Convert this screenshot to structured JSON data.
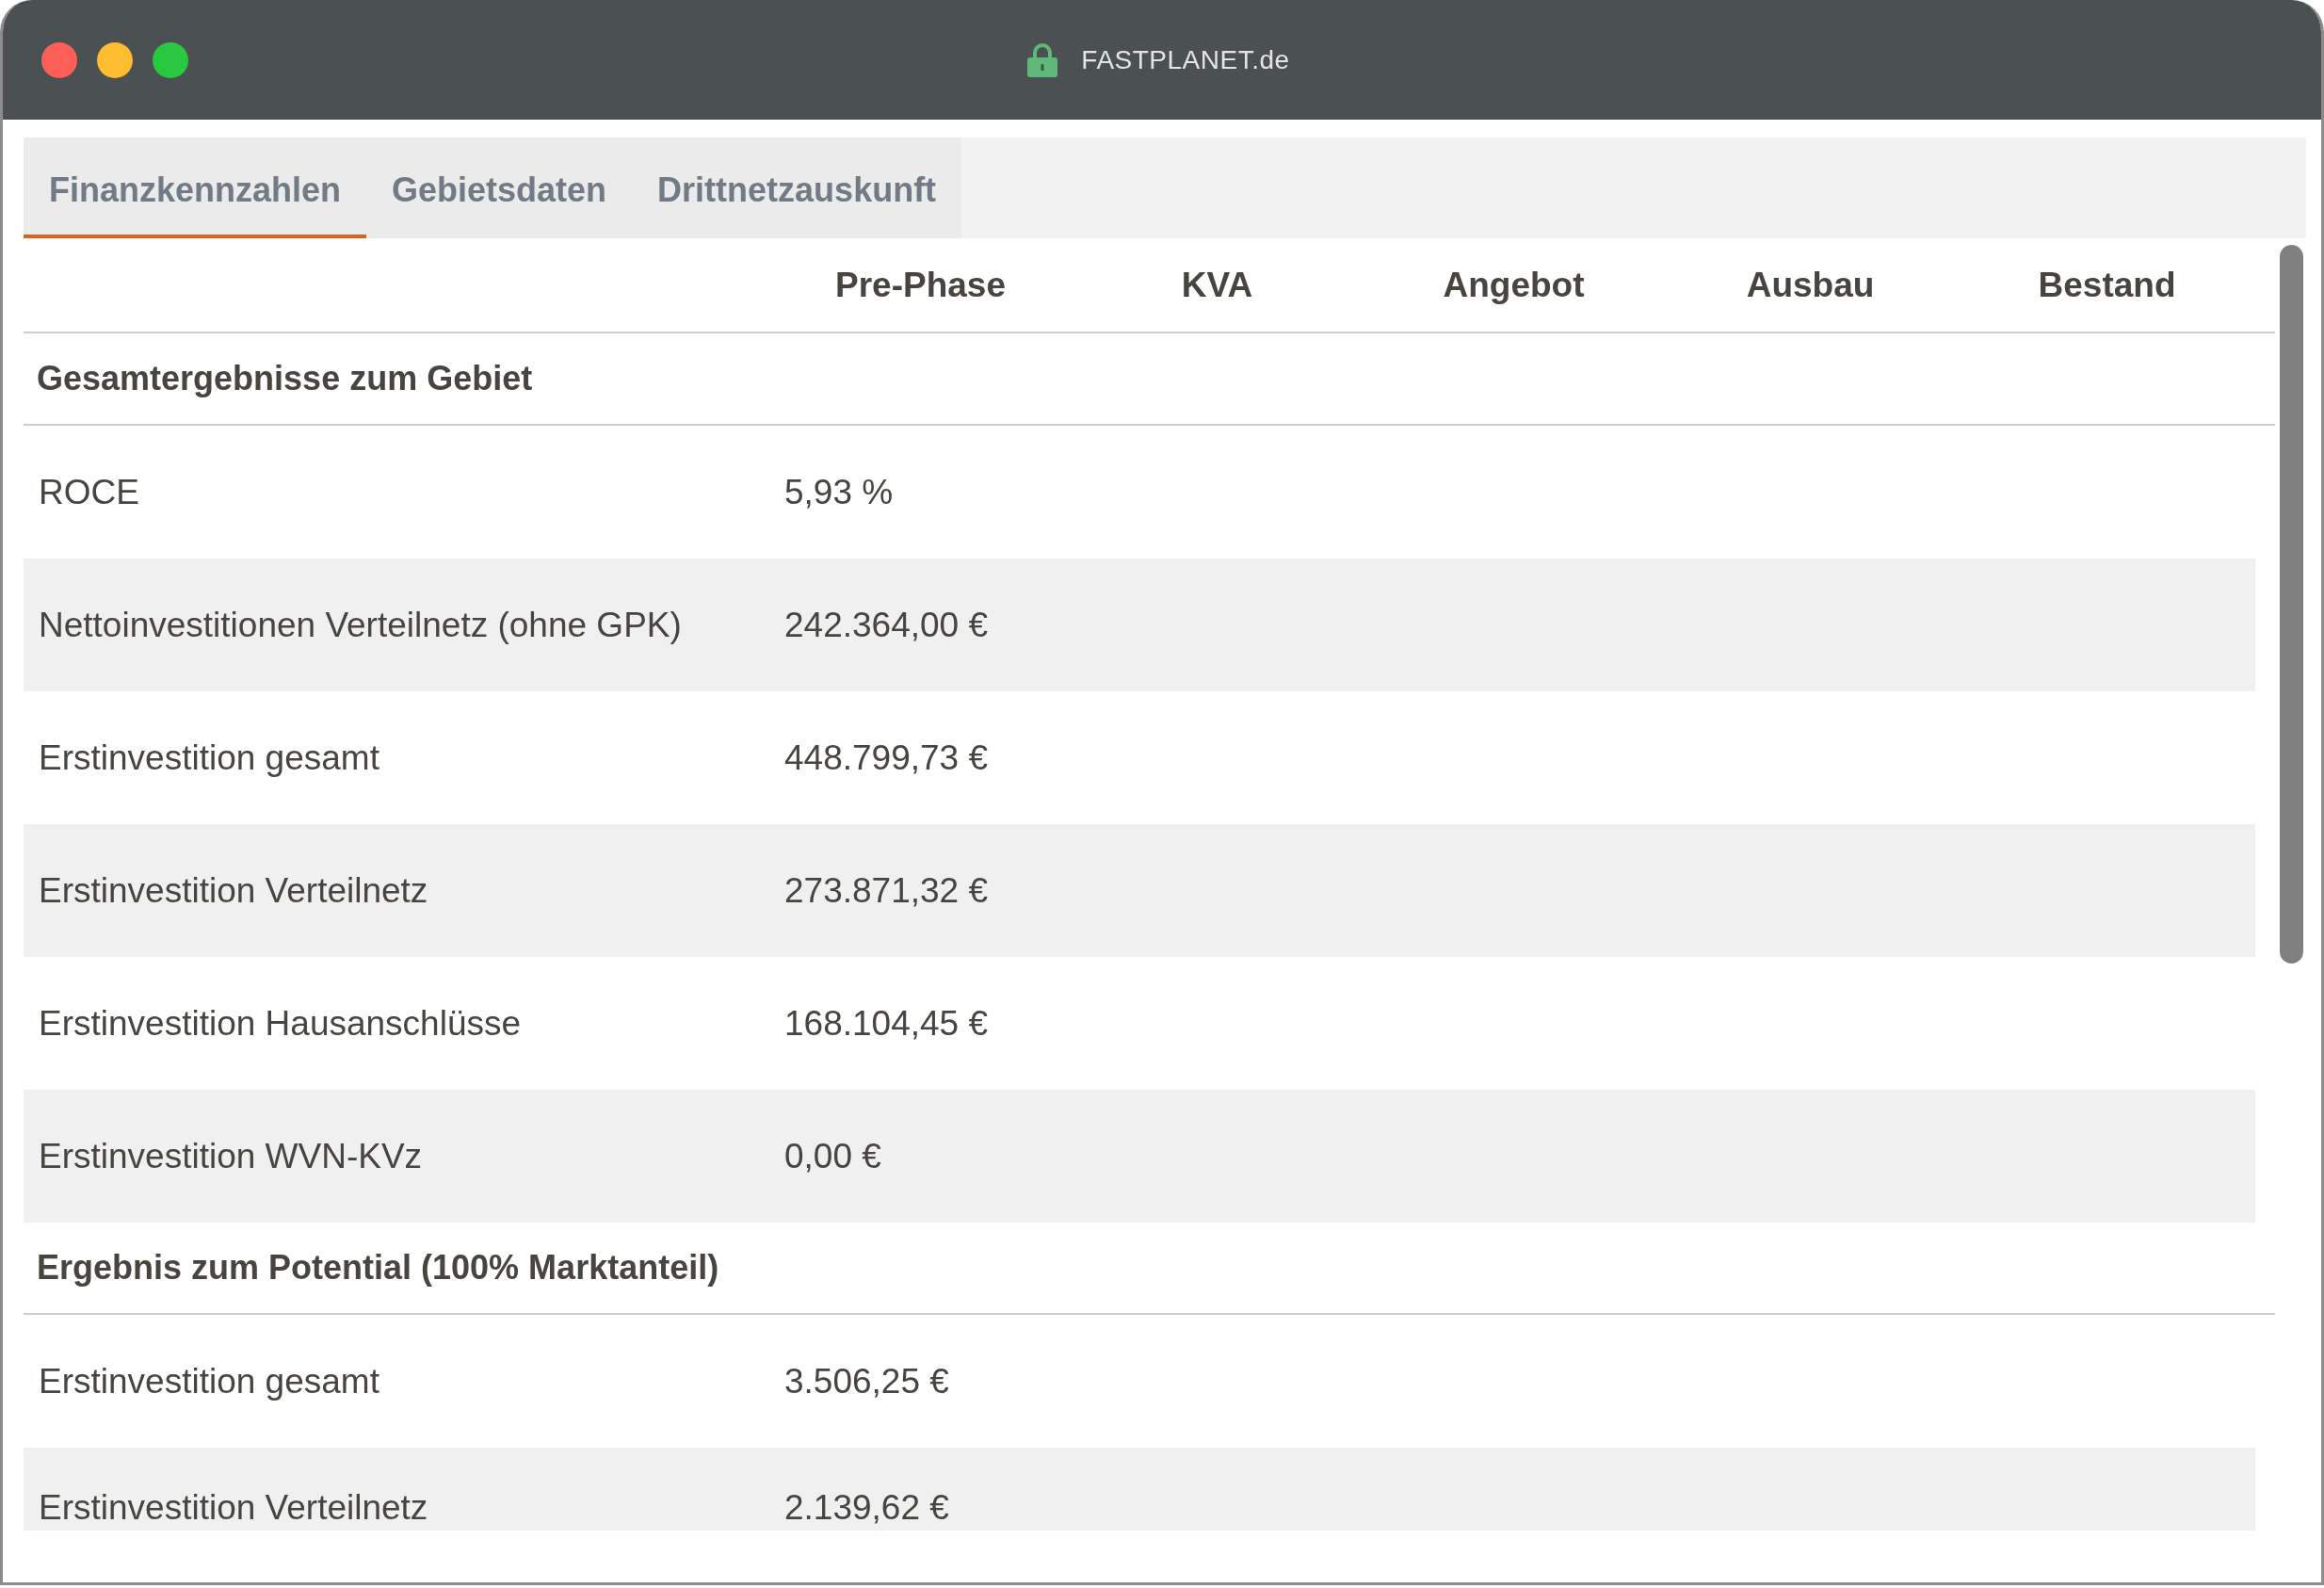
{
  "window": {
    "title": "FASTPLANET.de"
  },
  "tabs": [
    {
      "label": "Finanzkennzahlen",
      "selected": true
    },
    {
      "label": "Gebietsdaten",
      "selected": false
    },
    {
      "label": "Drittnetzauskunft",
      "selected": false
    }
  ],
  "table": {
    "columns": [
      "Pre-Phase",
      "KVA",
      "Angebot",
      "Ausbau",
      "Bestand"
    ],
    "rows": [
      {
        "kind": "section",
        "label": "Gesamtergebnisse zum Gebiet"
      },
      {
        "kind": "data",
        "label": "ROCE",
        "values": [
          "5,93 %"
        ]
      },
      {
        "kind": "data",
        "label": "Nettoinvestitionen Verteilnetz (ohne GPK)",
        "values": [
          "242.364,00 €"
        ]
      },
      {
        "kind": "data",
        "label": "Erstinvestition gesamt",
        "values": [
          "448.799,73 €"
        ]
      },
      {
        "kind": "data",
        "label": "Erstinvestition Verteilnetz",
        "values": [
          "273.871,32 €"
        ]
      },
      {
        "kind": "data",
        "label": "Erstinvestition Hausanschlüsse",
        "values": [
          "168.104,45 €"
        ]
      },
      {
        "kind": "data",
        "label": "Erstinvestition WVN-KVz",
        "values": [
          "0,00 €"
        ]
      },
      {
        "kind": "section",
        "label": "Ergebnis zum Potential (100% Marktanteil)"
      },
      {
        "kind": "data",
        "label": "Erstinvestition gesamt",
        "values": [
          "3.506,25 €"
        ]
      },
      {
        "kind": "data",
        "label": "Erstinvestition Verteilnetz",
        "values": [
          "2.139,62 €"
        ]
      }
    ]
  }
}
